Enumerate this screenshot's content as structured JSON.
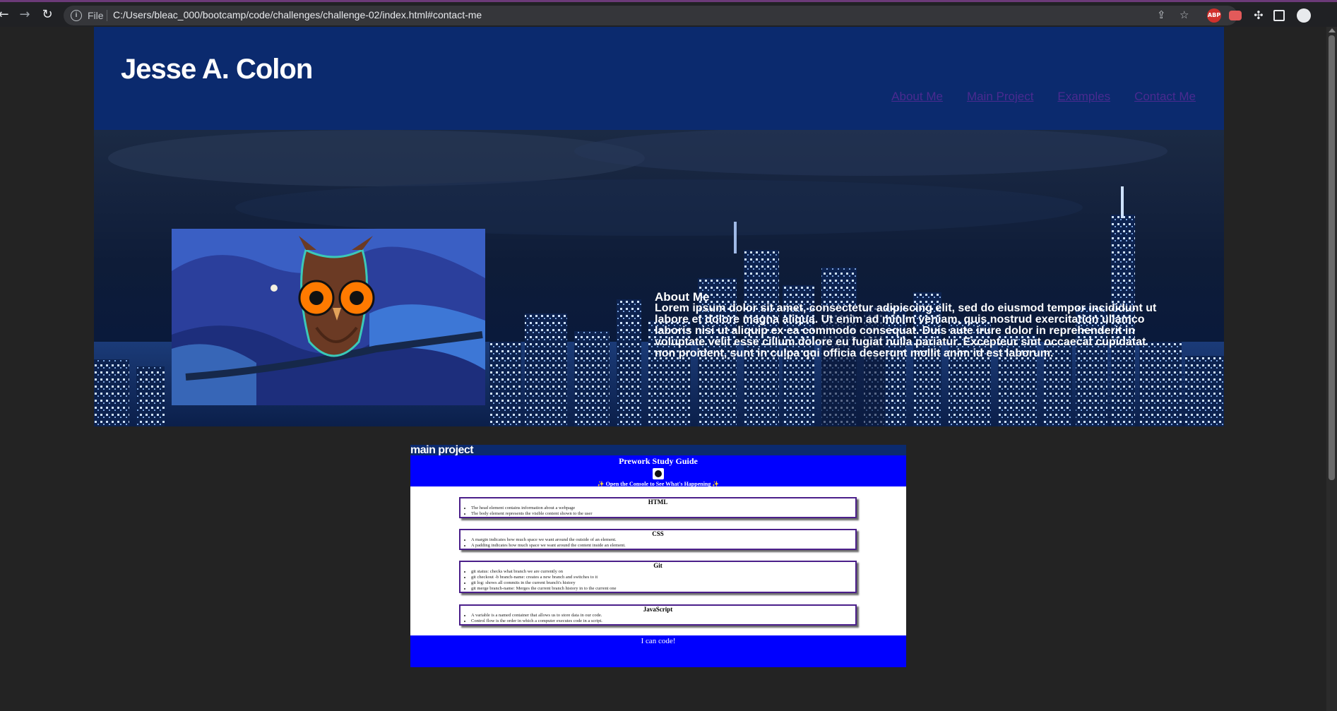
{
  "browser": {
    "scheme": "File",
    "url": "C:/Users/bleac_000/bootcamp/code/challenges/challenge-02/index.html#contact-me",
    "extension_adblock": "ABP"
  },
  "header": {
    "title": "Jesse A. Colon",
    "nav": [
      "About Me",
      "Main Project",
      "Examples",
      "Contact Me"
    ]
  },
  "about": {
    "heading": "About Me",
    "body": "Lorem ipsum dolor sit amet, consectetur adipiscing elit, sed do eiusmod tempor incididunt ut labore et dolore magna aliqua. Ut enim ad minim veniam, quis nostrud exercitation ullamco laboris nisi ut aliquip ex ea commodo consequat. Duis aute irure dolor in reprehenderit in voluptate velit esse cillum dolore eu fugiat nulla pariatur. Excepteur sint occaecat cupidatat non proident, sunt in culpa qui officia deserunt mollit anim id est laborum."
  },
  "main_project": {
    "heading": "main project",
    "title": "Prework Study Guide",
    "console_note": "✨ Open the Console to See What's Happening ✨",
    "cards": [
      {
        "title": "HTML",
        "items": [
          "The head element contains information about a webpage",
          "The body element represents the visible content shown to the user"
        ]
      },
      {
        "title": "CSS",
        "items": [
          "A margin indicates how much space we want around the outside of an element.",
          "A padding indicates how much space we want around the content inside an element."
        ]
      },
      {
        "title": "Git",
        "items": [
          "git status: checks what branch we are currently on",
          "git checkout -b branch-name: creates a new branch and switches to it",
          "git log: shows all commits in the current branch's history",
          "git merge branch-name: Merges the current branch history in to the current one"
        ]
      },
      {
        "title": "JavaScript",
        "items": [
          "A variable is a named container that allows us to store data in our code.",
          "Control flow is the order in which a computer executes code in a script."
        ]
      }
    ],
    "footer": "I can code!"
  }
}
